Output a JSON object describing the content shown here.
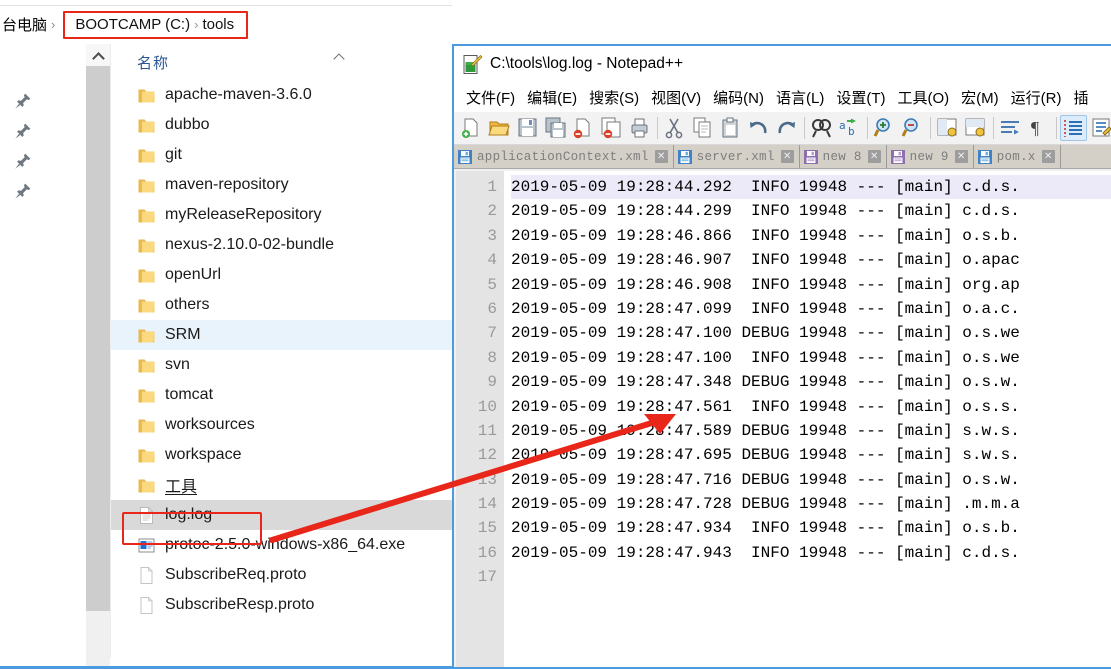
{
  "explorer": {
    "breadcrumb": {
      "this_pc": "台电脑",
      "separator": "›",
      "drive": "BOOTCAMP (C:)",
      "folder": "tools",
      "highlight_color": "#e8271a"
    },
    "nav_pane": {
      "pinned_icons": [
        "pin-icon",
        "pin-icon",
        "pin-icon",
        "pin-icon"
      ],
      "scroll_up_icon": "chevron-up-icon"
    },
    "column_header": {
      "name": "名称",
      "sort_icon": "sort-ascending-icon"
    },
    "items": [
      {
        "label": "apache-maven-3.6.0",
        "icon": "folder-icon",
        "state": "normal"
      },
      {
        "label": "dubbo",
        "icon": "folder-icon",
        "state": "normal"
      },
      {
        "label": "git",
        "icon": "folder-icon",
        "state": "normal"
      },
      {
        "label": "maven-repository",
        "icon": "folder-icon",
        "state": "normal"
      },
      {
        "label": "myReleaseRepository",
        "icon": "folder-icon",
        "state": "normal"
      },
      {
        "label": "nexus-2.10.0-02-bundle",
        "icon": "folder-icon",
        "state": "normal"
      },
      {
        "label": "openUrl",
        "icon": "folder-icon",
        "state": "normal"
      },
      {
        "label": "others",
        "icon": "folder-icon",
        "state": "normal"
      },
      {
        "label": "SRM",
        "icon": "folder-icon",
        "state": "selected-light"
      },
      {
        "label": "svn",
        "icon": "folder-icon",
        "state": "normal"
      },
      {
        "label": "tomcat",
        "icon": "folder-icon",
        "state": "normal"
      },
      {
        "label": "worksources",
        "icon": "folder-icon",
        "state": "normal"
      },
      {
        "label": "workspace",
        "icon": "folder-icon",
        "state": "normal"
      },
      {
        "label": "工具",
        "icon": "folder-icon",
        "state": "normal",
        "underline": true
      },
      {
        "label": "log.log",
        "icon": "file-icon",
        "state": "selected-gray",
        "highlighted": true
      },
      {
        "label": "protoc-2.5.0-windows-x86_64.exe",
        "icon": "exe-icon",
        "state": "normal"
      },
      {
        "label": "SubscribeReq.proto",
        "icon": "file-blank-icon",
        "state": "normal"
      },
      {
        "label": "SubscribeResp.proto",
        "icon": "file-blank-icon",
        "state": "normal"
      }
    ]
  },
  "notepadpp": {
    "title": "C:\\tools\\log.log - Notepad++",
    "app_icon": "notepadpp-icon",
    "menu": [
      "文件(F)",
      "编辑(E)",
      "搜索(S)",
      "视图(V)",
      "编码(N)",
      "语言(L)",
      "设置(T)",
      "工具(O)",
      "宏(M)",
      "运行(R)",
      "插"
    ],
    "toolbar": [
      "new-file-icon",
      "open-file-icon",
      "save-icon",
      "save-all-icon",
      "close-file-icon",
      "close-all-icon",
      "print-icon",
      "sep",
      "cut-icon",
      "copy-icon",
      "paste-icon",
      "undo-icon",
      "redo-icon",
      "sep",
      "find-icon",
      "replace-icon",
      "sep",
      "zoom-in-icon",
      "zoom-out-icon",
      "sep",
      "sync-vertical-icon",
      "sync-horizontal-icon",
      "sep",
      "word-wrap-icon",
      "show-all-chars-icon",
      "sep",
      "indent-guide-icon",
      "user-define-icon",
      "doc-map-icon"
    ],
    "tabs": [
      {
        "label": "applicationContext.xml",
        "icon": "save-blue-icon",
        "close": "✕",
        "active": false
      },
      {
        "label": "server.xml",
        "icon": "save-blue-icon",
        "close": "✕",
        "active": false
      },
      {
        "label": "new 8",
        "icon": "save-purple-icon",
        "close": "✕",
        "active": false
      },
      {
        "label": "new 9",
        "icon": "save-purple-icon",
        "close": "✕",
        "active": false
      },
      {
        "label": "pom.x",
        "icon": "save-blue-icon",
        "close": "✕",
        "active": false
      }
    ],
    "line_numbers": [
      "1",
      "2",
      "3",
      "4",
      "5",
      "6",
      "7",
      "8",
      "9",
      "10",
      "11",
      "12",
      "13",
      "14",
      "15",
      "16",
      "17"
    ],
    "lines": [
      "2019-05-09 19:28:44.292  INFO 19948 --- [main] c.d.s.",
      "2019-05-09 19:28:44.299  INFO 19948 --- [main] c.d.s.",
      "2019-05-09 19:28:46.866  INFO 19948 --- [main] o.s.b.",
      "2019-05-09 19:28:46.907  INFO 19948 --- [main] o.apac",
      "2019-05-09 19:28:46.908  INFO 19948 --- [main] org.ap",
      "2019-05-09 19:28:47.099  INFO 19948 --- [main] o.a.c.",
      "2019-05-09 19:28:47.100 DEBUG 19948 --- [main] o.s.we",
      "2019-05-09 19:28:47.100  INFO 19948 --- [main] o.s.we",
      "2019-05-09 19:28:47.348 DEBUG 19948 --- [main] o.s.w.",
      "2019-05-09 19:28:47.561  INFO 19948 --- [main] o.s.s.",
      "2019-05-09 19:28:47.589 DEBUG 19948 --- [main] s.w.s.",
      "2019-05-09 19:28:47.695 DEBUG 19948 --- [main] s.w.s.",
      "2019-05-09 19:28:47.716 DEBUG 19948 --- [main] o.s.w.",
      "2019-05-09 19:28:47.728 DEBUG 19948 --- [main] .m.m.a",
      "2019-05-09 19:28:47.934  INFO 19948 --- [main] o.s.b.",
      "2019-05-09 19:28:47.943  INFO 19948 --- [main] c.d.s.",
      ""
    ]
  },
  "annotation": {
    "arrow_color": "#e8271a",
    "arrow_from": "log.log file row",
    "arrow_to": "log file contents in Notepad++"
  }
}
